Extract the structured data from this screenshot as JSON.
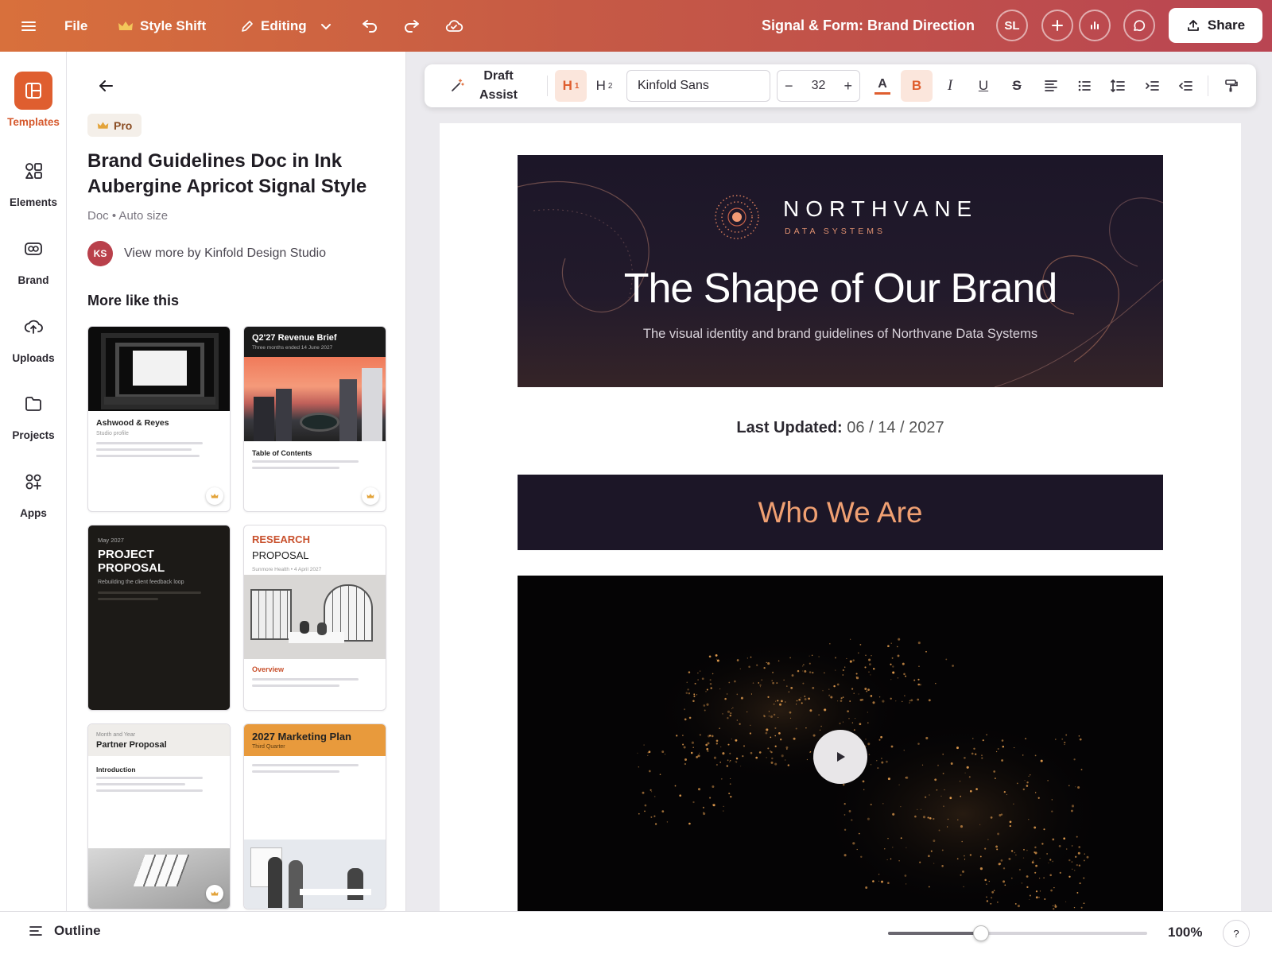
{
  "topbar": {
    "file": "File",
    "style_shift": "Style Shift",
    "editing": "Editing",
    "doc_title": "Signal & Form: Brand Direction",
    "avatar": "SL",
    "share": "Share"
  },
  "rail": [
    {
      "label": "Templates",
      "icon": "templates-icon"
    },
    {
      "label": "Elements",
      "icon": "elements-icon"
    },
    {
      "label": "Brand",
      "icon": "brand-icon"
    },
    {
      "label": "Uploads",
      "icon": "uploads-icon"
    },
    {
      "label": "Projects",
      "icon": "projects-icon"
    },
    {
      "label": "Apps",
      "icon": "apps-icon"
    }
  ],
  "panel": {
    "badge": "Pro",
    "title": "Brand Guidelines Doc in Ink Aubergine Apricot Signal Style",
    "meta": "Doc • Auto size",
    "author_initials": "KS",
    "author_link": "View more by Kinfold Design Studio",
    "more_heading": "More like this",
    "cards": {
      "c1": {
        "title": "Ashwood & Reyes",
        "sub": "Studio profile"
      },
      "c2": {
        "title": "Q2'27 Revenue Brief",
        "sub": "Three months ended 14 June 2027",
        "section": "Table of Contents"
      },
      "c3": {
        "date": "May 2027",
        "title": "PROJECT PROPOSAL",
        "sub": "Rebuilding the client feedback loop"
      },
      "c4": {
        "kicker": "RESEARCH",
        "title": "PROPOSAL",
        "sub": "Sunmore Health • 4 April 2027",
        "section": "Overview"
      },
      "c5": {
        "date": "Month and Year",
        "title": "Partner Proposal",
        "section": "Introduction"
      },
      "c6": {
        "title": "2027 Marketing Plan",
        "sub": "Third Quarter"
      }
    }
  },
  "toolbar": {
    "draft_assist": "Draft Assist",
    "h1": "H",
    "h1_level": "1",
    "h2": "H",
    "h2_level": "2",
    "font": "Kinfold Sans",
    "font_size": "32",
    "bold": "B",
    "italic": "I",
    "underline": "U",
    "strike": "S",
    "color_letter": "A",
    "accent_color": "#df5e2f"
  },
  "doc": {
    "brand_name": "NORTHVANE",
    "brand_tag": "DATA SYSTEMS",
    "hero_title": "The Shape of Our Brand",
    "hero_sub": "The visual identity and brand guidelines of Northvane Data Systems",
    "updated_label": "Last Updated:",
    "updated_value": "06 / 14 / 2027",
    "section_heading": "Who We Are"
  },
  "bottom": {
    "outline": "Outline",
    "zoom": "100%",
    "zoom_level": 0.36,
    "help": "?"
  }
}
